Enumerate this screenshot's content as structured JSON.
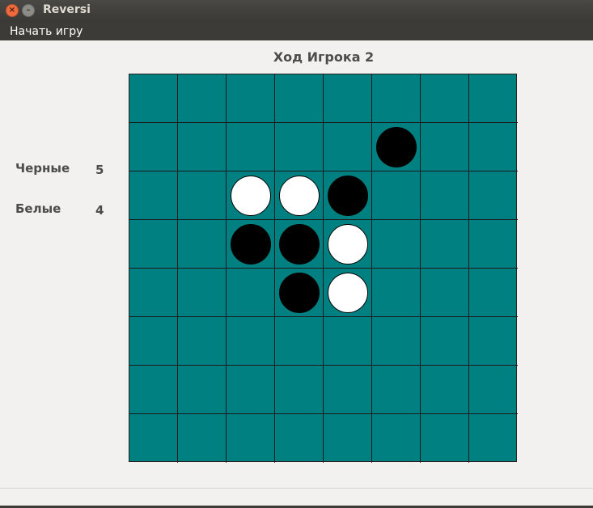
{
  "window": {
    "title": "Reversi",
    "close_symbol": "×",
    "minimize_symbol": "–"
  },
  "menu": {
    "items": [
      {
        "label": "Начать игру"
      }
    ]
  },
  "status": {
    "text": "Ход Игрока 2"
  },
  "scores": {
    "black": {
      "label": "Черные",
      "value": "5"
    },
    "white": {
      "label": "Белые",
      "value": "4"
    }
  },
  "board": {
    "size": 8,
    "colors": {
      "board": "#008080",
      "black_disc": "#000000",
      "white_disc": "#ffffff"
    },
    "pieces": [
      {
        "row": 1,
        "col": 5,
        "color": "black"
      },
      {
        "row": 2,
        "col": 2,
        "color": "white"
      },
      {
        "row": 2,
        "col": 3,
        "color": "white"
      },
      {
        "row": 2,
        "col": 4,
        "color": "black"
      },
      {
        "row": 3,
        "col": 2,
        "color": "black"
      },
      {
        "row": 3,
        "col": 3,
        "color": "black"
      },
      {
        "row": 3,
        "col": 4,
        "color": "white"
      },
      {
        "row": 4,
        "col": 3,
        "color": "black"
      },
      {
        "row": 4,
        "col": 4,
        "color": "white"
      }
    ]
  }
}
